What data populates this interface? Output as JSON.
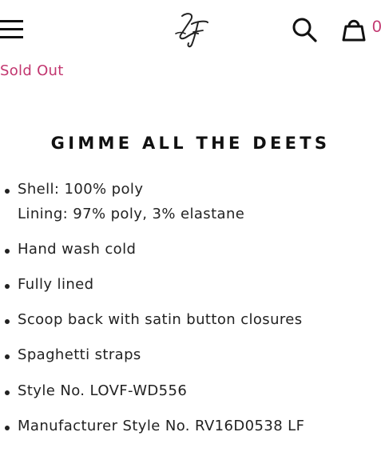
{
  "header": {
    "logo_text": "LF",
    "cart_count": "0"
  },
  "product": {
    "status": "Sold Out"
  },
  "details": {
    "title": "GIMME ALL THE DEETS",
    "items": [
      {
        "text": "Shell: 100% poly",
        "subtext": "Lining: 97% poly, 3% elastane"
      },
      {
        "text": "Hand wash cold"
      },
      {
        "text": "Fully lined"
      },
      {
        "text": "Scoop back with satin button closures"
      },
      {
        "text": "Spaghetti straps"
      },
      {
        "text": "Style No. LOVF-WD556"
      },
      {
        "text": "Manufacturer Style No. RV16D0538 LF"
      }
    ]
  },
  "icons": {
    "menu": "hamburger-menu-icon",
    "search": "search-icon",
    "cart": "shopping-bag-icon"
  },
  "colors": {
    "accent": "#c2366f",
    "text": "#222222"
  }
}
